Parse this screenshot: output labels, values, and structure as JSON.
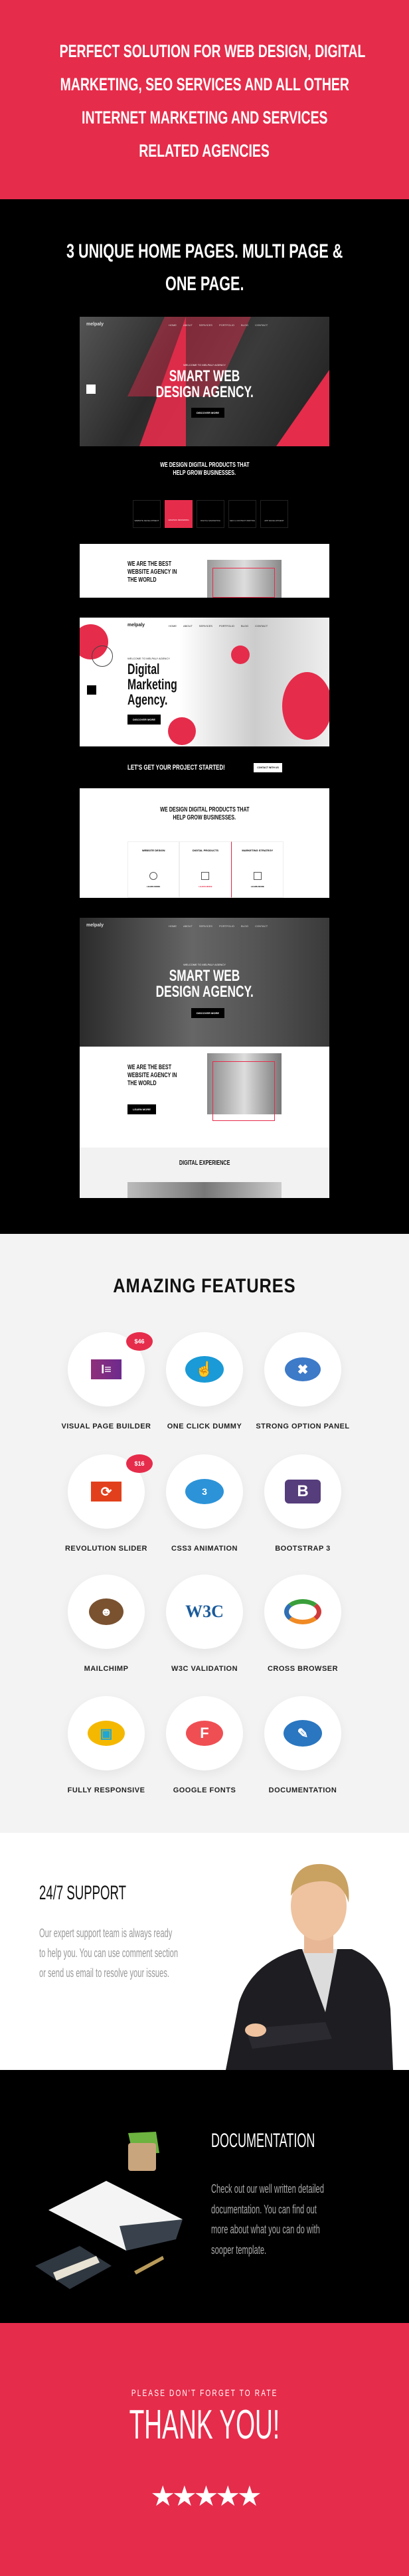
{
  "colors": {
    "brand_red": "#e62c4b",
    "black": "#000000",
    "light_gray": "#f3f3f3"
  },
  "intro": {
    "lines": [
      "PERFECT SOLUTION FOR WEB DESIGN, DIGITAL",
      "MARKETING, SEO SERVICES AND ALL OTHER",
      "INTERNET MARKETING AND SERVICES",
      "RELATED AGENCIES"
    ]
  },
  "homes": {
    "title_lines": [
      "3 UNIQUE HOME PAGES. MULTI PAGE &",
      "ONE PAGE."
    ],
    "mock": {
      "logo": "melpaly",
      "nav": [
        "HOME",
        "ABOUT",
        "SERVICES",
        "PORTFOLIO",
        "BLOG",
        "CONTACT"
      ],
      "welcome": "WELCOME TO MELPALY AGENCY",
      "hero1": [
        "SMART WEB",
        "DESIGN AGENCY."
      ],
      "discover": "DISCOVER MORE",
      "products_title": [
        "WE DESIGN DIGITAL PRODUCTS THAT",
        "HELP GROW BUSINESSES."
      ],
      "service_boxes": [
        "WEBSITE DEVELOPMENT",
        "GRAPHIC DESIGNING",
        "DIGITAL MARKETING",
        "SEO & CONTENT WRITING",
        "APP DEVELOPMENT"
      ],
      "best_title": [
        "WE ARE THE BEST",
        "WEBSITE AGENCY IN",
        "THE WORLD"
      ],
      "hero2": [
        "Digital",
        "Marketing",
        "Agency."
      ],
      "cta": "LET'S GET YOUR PROJECT STARTED!",
      "cta_button": "CONTACT WITH US",
      "cards": [
        "WEBSITE DESIGN",
        "DIGITAL PRODUCTS",
        "MARKETING STRATEGY"
      ],
      "learn_more": "LEARN MORE",
      "experience": "DIGITAL EXPERIENCE"
    }
  },
  "features": {
    "title": "AMAZING FEATURES",
    "items": [
      {
        "label": "VISUAL PAGE BUILDER",
        "icon": "elementor-icon",
        "badge": "$46"
      },
      {
        "label": "ONE CLICK DUMMY",
        "icon": "hand-click-icon"
      },
      {
        "label": "STRONG OPTION PANEL",
        "icon": "tools-icon"
      },
      {
        "label": "REVOLUTION SLIDER",
        "icon": "revolution-slider-icon",
        "badge": "$16"
      },
      {
        "label": "CSS3 ANIMATION",
        "icon": "css3-icon"
      },
      {
        "label": "BOOTSTRAP 3",
        "icon": "bootstrap-icon"
      },
      {
        "label": "MAILCHIMP",
        "icon": "mailchimp-icon"
      },
      {
        "label": "W3C VALIDATION",
        "icon": "w3c-icon"
      },
      {
        "label": "CROSS BROWSER",
        "icon": "cross-browser-icon"
      },
      {
        "label": "FULLY RESPONSIVE",
        "icon": "responsive-devices-icon"
      },
      {
        "label": "GOOGLE FONTS",
        "icon": "google-fonts-icon"
      },
      {
        "label": "DOCUMENTATION",
        "icon": "documentation-icon"
      }
    ]
  },
  "support": {
    "title": "24/7 SUPPORT",
    "body": [
      "Our expert support team is always ready",
      "to help you. You can use comment section",
      "or send us email to resolve your issues."
    ]
  },
  "docs": {
    "title": "DOCUMENTATION",
    "body": [
      "Check out our well written detailed",
      "documentation. You can find out",
      "more about what you can do with",
      "sooper template."
    ]
  },
  "thanks": {
    "pre": "PLEASE DON'T FORGET TO RATE",
    "title": "THANK YOU!",
    "rating": 5
  }
}
